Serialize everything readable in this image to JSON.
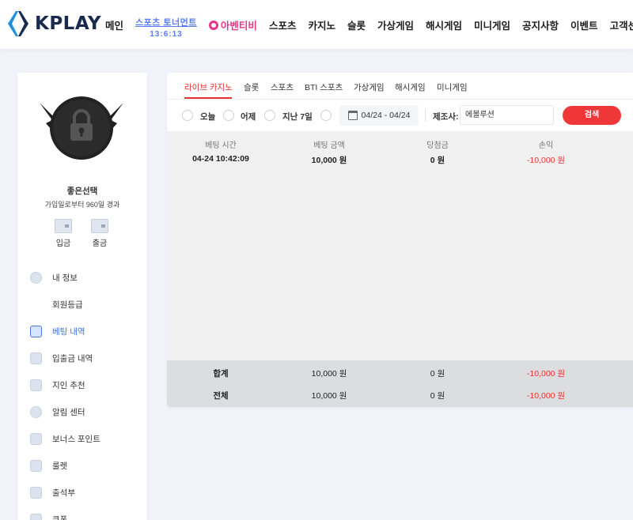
{
  "header": {
    "logo_text": "KPLAY",
    "nav": {
      "main": "메인",
      "sports_tournament": "스포츠 토너먼트",
      "countdown": "13:6:13",
      "live_tv": "아벤티비",
      "sports": "스포츠",
      "casino": "카지노",
      "slot": "슬롯",
      "virtual": "가상게임",
      "hash": "해시게임",
      "mini": "미니게임",
      "notice": "공지사항",
      "event": "이벤트",
      "support": "고객센터"
    }
  },
  "sidebar": {
    "username": "좋은선택",
    "joined": "가입일로부터 960일 경과",
    "deposit": "입금",
    "withdraw": "출금",
    "menu": [
      {
        "label": "내 정보",
        "icon": "user-icon"
      },
      {
        "label": "회원등급",
        "icon": "none"
      },
      {
        "label": "베팅 내역",
        "icon": "document-icon",
        "active": true
      },
      {
        "label": "입출금 내역",
        "icon": "wallet-icon"
      },
      {
        "label": "지인 추천",
        "icon": "mail-icon"
      },
      {
        "label": "알림 센터",
        "icon": "chat-icon"
      },
      {
        "label": "보너스 포인트",
        "icon": "wallet-icon"
      },
      {
        "label": "룰렛",
        "icon": "star-icon"
      },
      {
        "label": "출석부",
        "icon": "check-icon"
      },
      {
        "label": "쿠폰",
        "icon": "calendar-icon"
      }
    ]
  },
  "tabs": [
    "라이브 카지노",
    "슬롯",
    "스포츠",
    "BTI 스포츠",
    "가상게임",
    "해시게임",
    "미니게임"
  ],
  "filter": {
    "today": "오늘",
    "yesterday": "어제",
    "last7": "지난 7일",
    "date_range": "04/24 - 04/24",
    "provider_label": "제조사:",
    "provider_value": "에볼루션",
    "search": "검색"
  },
  "table": {
    "headers": [
      "베팅 시간",
      "베팅 금액",
      "당첨금",
      "손익"
    ],
    "rows": [
      [
        "04-24 10:42:09",
        "10,000 원",
        "0 원",
        "-10,000 원"
      ]
    ],
    "subtotal": [
      "합계",
      "10,000 원",
      "0 원",
      "-10,000 원"
    ],
    "total": [
      "전체",
      "10,000 원",
      "0 원",
      "-10,000 원"
    ]
  },
  "colors": {
    "accent_red": "#ef3737",
    "link_blue": "#3d6fe0",
    "brand_navy": "#1a2a4f"
  }
}
